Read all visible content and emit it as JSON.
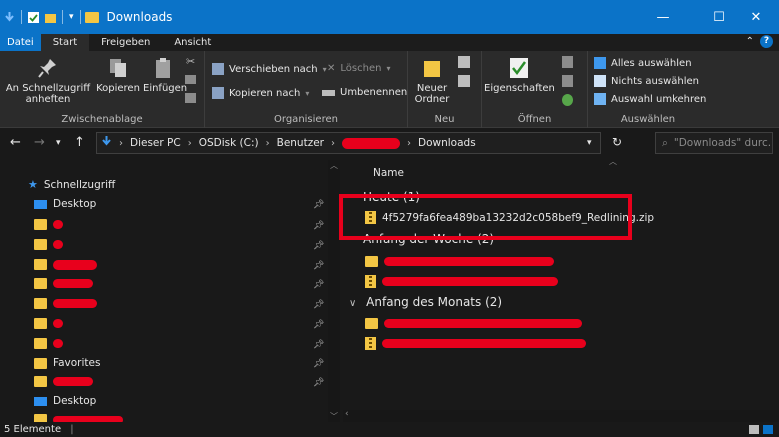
{
  "window": {
    "title": "Downloads",
    "minimize": "—",
    "maximize": "☐",
    "close": "✕"
  },
  "ribbon_tabs": [
    "Datei",
    "Start",
    "Freigeben",
    "Ansicht"
  ],
  "ribbon": {
    "clipboard": {
      "pin_label": "An Schnellzugriff anheften",
      "copy_label": "Kopieren",
      "paste_label": "Einfügen",
      "group_label": "Zwischenablage"
    },
    "organize": {
      "move_label": "Verschieben nach",
      "copy_to_label": "Kopieren nach",
      "delete_label": "Löschen",
      "rename_label": "Umbenennen",
      "group_label": "Organisieren"
    },
    "new": {
      "new_folder_label": "Neuer Ordner",
      "group_label": "Neu"
    },
    "open": {
      "properties_label": "Eigenschaften",
      "group_label": "Öffnen"
    },
    "select": {
      "select_all_label": "Alles auswählen",
      "select_none_label": "Nichts auswählen",
      "invert_label": "Auswahl umkehren",
      "group_label": "Auswählen"
    }
  },
  "address": {
    "segments": [
      "Dieser PC",
      "OSDisk (C:)",
      "Benutzer",
      "Downloads"
    ],
    "search_placeholder": "\"Downloads\" durc..."
  },
  "nav_pane": {
    "quick_access": "Schnellzugriff",
    "items": [
      {
        "label": "Desktop",
        "icon": "desktop-icon"
      },
      {
        "label": "Favorites",
        "icon": "folder-icon"
      },
      {
        "label": "Desktop",
        "icon": "desktop-icon"
      }
    ]
  },
  "content": {
    "column_name": "Name",
    "groups": [
      {
        "label": "Heute (1)"
      },
      {
        "label": "Anfang der Woche (2)"
      },
      {
        "label": "Anfang des Monats (2)"
      }
    ],
    "file_today": "4f5279fa6fea489ba13232d2c058bef9_Redlining.zip"
  },
  "status": {
    "count": "5 Elemente"
  },
  "colors": {
    "accent": "#0b73c8",
    "redaction": "#e8001c",
    "folder": "#f3c644"
  }
}
